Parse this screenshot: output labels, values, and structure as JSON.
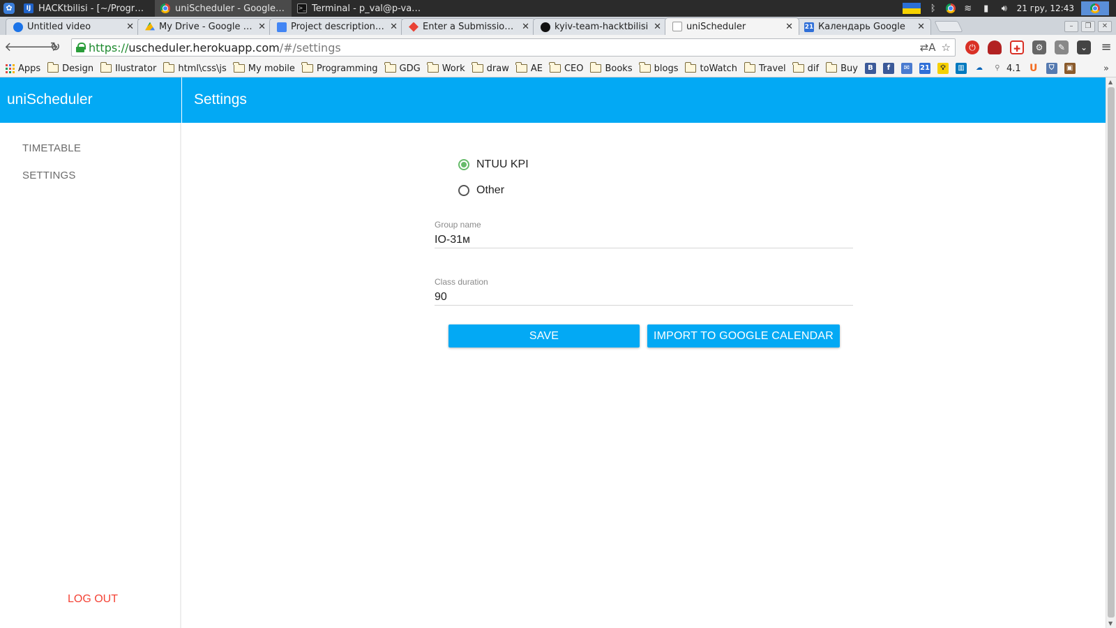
{
  "taskbar": {
    "tasks": [
      {
        "label": "HACKtbilisi - [~/Programs/..."
      },
      {
        "label": "uniScheduler - Google Chr..."
      },
      {
        "label": "Terminal - p_val@p-val-PC: ..."
      }
    ],
    "clock": "21 гру, 12:43"
  },
  "browser": {
    "tabs": [
      {
        "title": "Untitled video"
      },
      {
        "title": "My Drive - Google Drive"
      },
      {
        "title": "Project description - Go"
      },
      {
        "title": "Enter a Submission | ha"
      },
      {
        "title": "kyiv-team-hacktbilisi"
      },
      {
        "title": "uniScheduler"
      },
      {
        "title": "Календарь Google"
      }
    ],
    "url": {
      "scheme": "https://",
      "host": "uscheduler.herokuapp.com",
      "path": "/#/settings"
    },
    "ext_badge": "4.1",
    "bookmarks": [
      "Apps",
      "Design",
      "Ilustrator",
      "html\\css\\js",
      "My mobile",
      "Programming",
      "GDG",
      "Work",
      "draw",
      "AE",
      "CEO",
      "Books",
      "blogs",
      "toWatch",
      "Travel",
      "dif",
      "Buy"
    ]
  },
  "app": {
    "brand": "uniScheduler",
    "page_title": "Settings",
    "nav": {
      "timetable": "TIMETABLE",
      "settings": "SETTINGS",
      "logout": "LOG OUT"
    },
    "university": {
      "options": [
        "NTUU KPI",
        "Other"
      ],
      "selected": "NTUU KPI"
    },
    "group_name": {
      "label": "Group name",
      "value": "IO-31м"
    },
    "class_duration": {
      "label": "Class duration",
      "value": "90"
    },
    "buttons": {
      "save": "SAVE",
      "import": "IMPORT TO GOOGLE CALENDAR"
    }
  },
  "colors": {
    "accent": "#03a9f4",
    "radio_checked": "#66bb6a",
    "logout": "#f44336"
  }
}
